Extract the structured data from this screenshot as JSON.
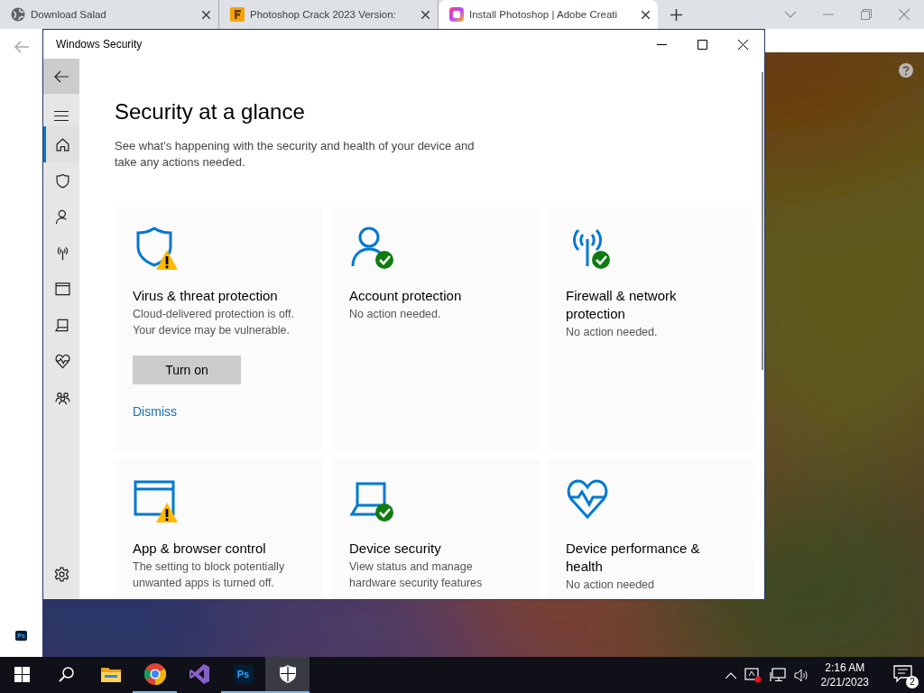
{
  "browser": {
    "tabs": [
      {
        "kind": "globe",
        "title": "Download Salad",
        "selected": false
      },
      {
        "kind": "tile",
        "title": "Photoshop Crack 2023 Version:",
        "selected": false
      },
      {
        "kind": "gradient",
        "title": "Install Photoshop | Adobe Creati",
        "selected": true
      }
    ],
    "page": {
      "badge": "Ps"
    }
  },
  "window": {
    "title": "Windows Security",
    "nav": [
      {
        "kind": "home",
        "selected": true
      },
      {
        "kind": "shield",
        "selected": false
      },
      {
        "kind": "person",
        "selected": false
      },
      {
        "kind": "antenna",
        "selected": false
      },
      {
        "kind": "browser",
        "selected": false
      },
      {
        "kind": "laptop",
        "selected": false
      },
      {
        "kind": "heart",
        "selected": false
      },
      {
        "kind": "family",
        "selected": false
      }
    ],
    "heading": "Security at a glance",
    "subtitle": "See what's happening with the security and health of your device and take any actions needed.",
    "cards": [
      {
        "kind": "shield",
        "warning": true,
        "verified": false,
        "title": "Virus & threat protection",
        "text": "Cloud-delivered protection is off. Your device may be vulnerable.",
        "button": "Turn on",
        "link": "Dismiss"
      },
      {
        "kind": "person",
        "warning": false,
        "verified": true,
        "title": "Account protection",
        "text": "No action needed."
      },
      {
        "kind": "antenna",
        "warning": false,
        "verified": true,
        "title": "Firewall & network protection",
        "text": "No action needed."
      },
      {
        "kind": "browser",
        "warning": true,
        "verified": false,
        "title": "App & browser control",
        "text": "The setting to block potentially unwanted apps is turned off."
      },
      {
        "kind": "laptop",
        "warning": false,
        "verified": true,
        "title": "Device security",
        "text": "View status and manage hardware security features"
      },
      {
        "kind": "heart",
        "warning": false,
        "verified": false,
        "title": "Device performance & health",
        "text": "No action needed"
      }
    ]
  },
  "taskbar": {
    "apps": [
      {
        "kind": "folder",
        "running": false,
        "selected": false
      },
      {
        "kind": "chrome",
        "running": true,
        "selected": false
      },
      {
        "kind": "infinity",
        "running": false,
        "selected": false
      },
      {
        "kind": "ps",
        "label": "Ps",
        "running": true,
        "selected": false
      },
      {
        "kind": "shield",
        "running": true,
        "selected": true
      }
    ],
    "time": "2:16 AM",
    "date": "2/21/2023",
    "notifications": "2"
  }
}
